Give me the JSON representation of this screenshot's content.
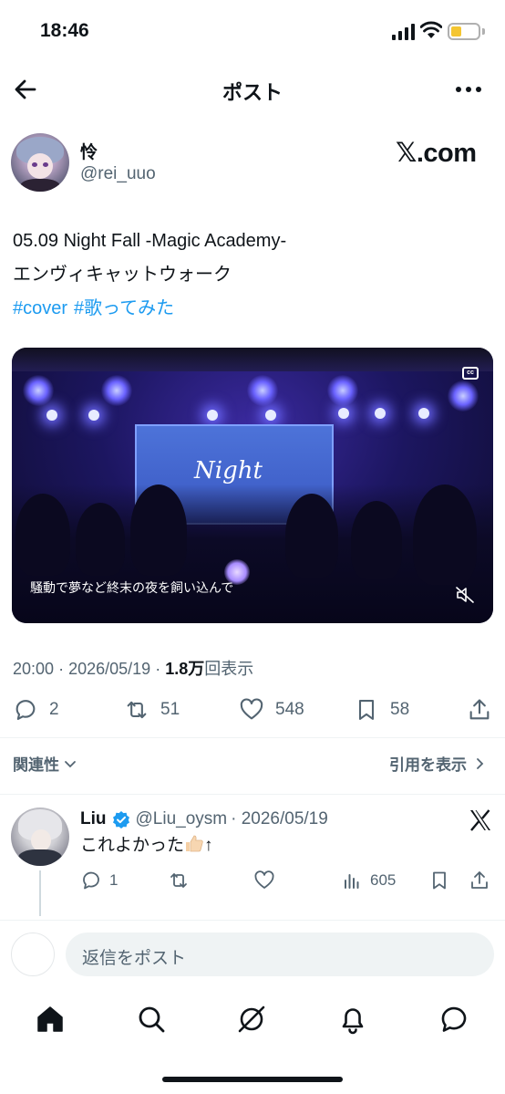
{
  "status_bar": {
    "time": "18:46"
  },
  "header": {
    "title": "ポスト"
  },
  "post": {
    "author_name": "怜",
    "author_handle": "@rei_uuo",
    "source_logo": "𝕏.com",
    "text_line1": "05.09 Night Fall -Magic Academy-",
    "text_line2": "エンヴィキャットウォーク",
    "hashtags": [
      "#cover",
      "#歌ってみた"
    ],
    "video": {
      "caption": "騒動で夢など終末の夜を飼い込んで",
      "cc_label": "cc",
      "screen_text": "Night"
    },
    "meta": {
      "time": "20:00",
      "date": "2026/05/19",
      "views_count": "1.8万",
      "views_label": "回表示",
      "separator": "·"
    },
    "actions": {
      "replies": "2",
      "reposts": "51",
      "likes": "548",
      "bookmarks": "58"
    }
  },
  "sort": {
    "left_label": "関連性",
    "right_label": "引用を表示"
  },
  "reply": {
    "name": "Liu",
    "handle": "@Liu_oysm",
    "date": "· 2026/05/19",
    "text": "これよかった",
    "text_suffix": "↑",
    "actions": {
      "replies": "1",
      "views": "605"
    }
  },
  "composer": {
    "placeholder": "返信をポスト"
  },
  "icons": {
    "back": "arrow-left-icon",
    "more": "more-dots-icon",
    "reply": "reply-bubble-icon",
    "repost": "repost-icon",
    "like": "heart-icon",
    "bookmark": "bookmark-icon",
    "share": "share-icon",
    "verified": "verified-badge-icon",
    "nav": [
      "home-icon",
      "search-icon",
      "grok-icon",
      "notifications-icon",
      "messages-icon"
    ]
  },
  "colors": {
    "link": "#1d9bf0",
    "secondary_text": "#536471",
    "primary_text": "#0f1419",
    "verified": "#1d9bf0"
  }
}
